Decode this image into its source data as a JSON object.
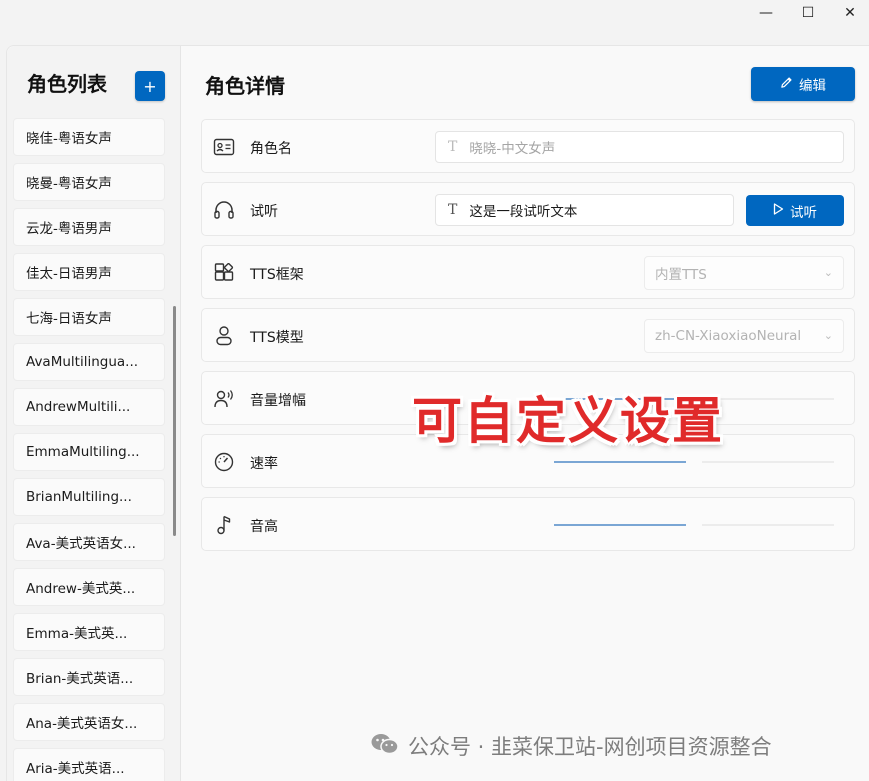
{
  "window": {
    "minimize_glyph": "—",
    "maximize_glyph": "☐",
    "close_glyph": "✕"
  },
  "sidebar": {
    "title": "角色列表",
    "add_label": "+",
    "items": [
      {
        "label": "晓佳-粤语女声"
      },
      {
        "label": "晓曼-粤语女声"
      },
      {
        "label": "云龙-粤语男声"
      },
      {
        "label": "佳太-日语男声"
      },
      {
        "label": "七海-日语女声"
      },
      {
        "label": "AvaMultilingua..."
      },
      {
        "label": "AndrewMultili..."
      },
      {
        "label": "EmmaMultiling..."
      },
      {
        "label": "BrianMultiling..."
      },
      {
        "label": "Ava-美式英语女..."
      },
      {
        "label": "Andrew-美式英..."
      },
      {
        "label": "Emma-美式英..."
      },
      {
        "label": "Brian-美式英语..."
      },
      {
        "label": "Ana-美式英语女..."
      },
      {
        "label": "Aria-美式英语..."
      }
    ]
  },
  "main": {
    "title": "角色详情",
    "edit_label": "编辑",
    "fields": {
      "name": {
        "label": "角色名",
        "value": "晓晓-中文女声"
      },
      "listen": {
        "label": "试听",
        "value": "这是一段试听文本",
        "button_label": "试听"
      },
      "framework": {
        "label": "TTS框架",
        "value": "内置TTS"
      },
      "model": {
        "label": "TTS模型",
        "value": "zh-CN-XiaoxiaoNeural"
      },
      "volume": {
        "label": "音量增幅",
        "level": 0.5
      },
      "rate": {
        "label": "速率",
        "level": 0.5
      },
      "pitch": {
        "label": "音高",
        "level": 0.5
      }
    }
  },
  "overlay": {
    "text": "可自定义设置"
  },
  "watermark": {
    "text": "公众号 · 韭菜保卫站-网创项目资源整合"
  },
  "colors": {
    "accent": "#0067c0",
    "overlay_text": "#e02a2a",
    "slider_fill": "#7aa6d4"
  }
}
